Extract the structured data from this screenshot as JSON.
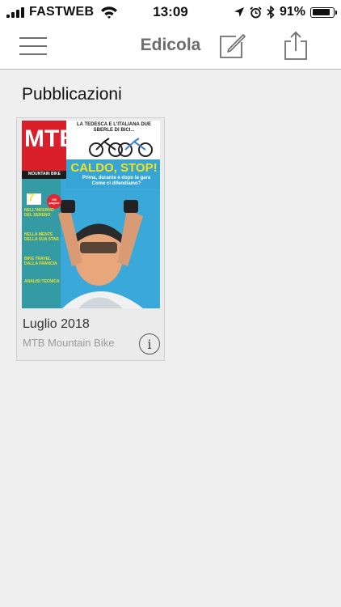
{
  "status_bar": {
    "carrier": "FASTWEB",
    "time": "13:09",
    "battery_text": "91%",
    "battery_level": 0.91,
    "icons": [
      "signal-icon",
      "wifi-icon",
      "location-arrow-icon",
      "alarm-icon",
      "bluetooth-icon",
      "battery-icon"
    ]
  },
  "nav": {
    "title": "Edicola",
    "icons": [
      "menu-icon",
      "compose-icon",
      "share-icon"
    ]
  },
  "section": {
    "title": "Pubblicazioni"
  },
  "publications": [
    {
      "issue": "Luglio 2018",
      "publisher": "MTB Mountain Bike",
      "cover": {
        "logo": "MTB",
        "logo_sub": "MOUNTAIN BIKE",
        "top_banner": "LA TEDESCA E L'ITALIANA DUE SBERLE DI BICI...",
        "headline": "CALDO, STOP!",
        "subheadline": "Prima, durante e dopo la gara Come ci difendiamo?",
        "issue_number": "7",
        "badge": "196 pagine",
        "side_heads": [
          "NELL'INFERNO DEL SERENO",
          "NELLA MENTE DELLA SUA STAR",
          "BIKE TRAVEL DALLA FRANCIA",
          "ANALISI TECNICA"
        ]
      },
      "info_glyph": "i"
    }
  ],
  "colors": {
    "nav_title": "#6d6d6d",
    "background": "#efefef",
    "cover_red": "#d9202a",
    "cover_yellow": "#f4e21b",
    "cover_sky": "#37a7d8"
  }
}
